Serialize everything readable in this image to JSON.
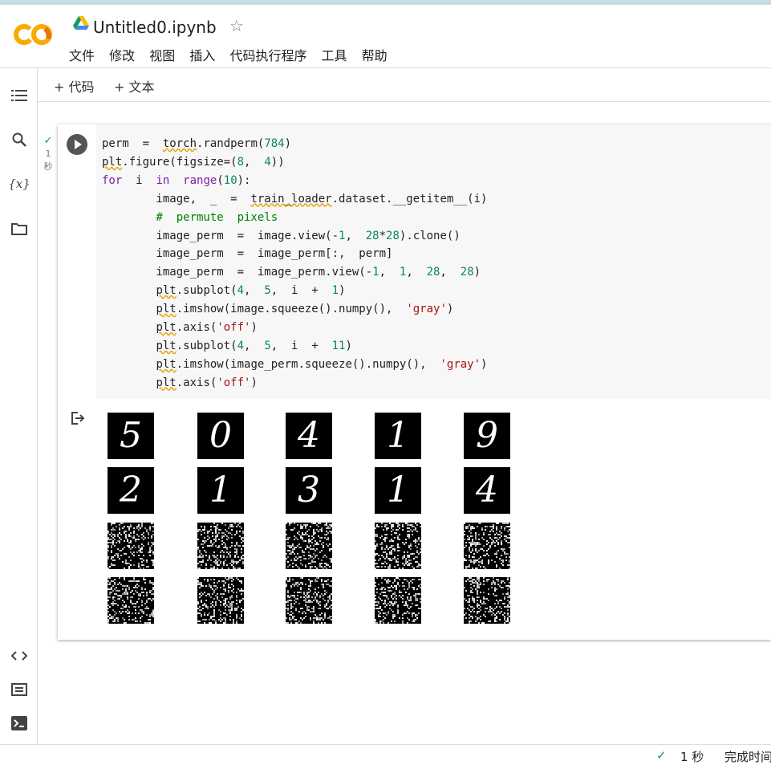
{
  "header": {
    "logo_text": "CO",
    "filename": "Untitled0.ipynb",
    "star_glyph": "☆",
    "menu": [
      "文件",
      "修改",
      "视图",
      "插入",
      "代码执行程序",
      "工具",
      "帮助"
    ]
  },
  "toolbar": {
    "add_code": "代码",
    "add_text": "文本"
  },
  "sidebar": {
    "top_icons": [
      "table-of-contents-icon",
      "search-icon",
      "variables-icon",
      "files-icon"
    ],
    "bottom_icons": [
      "code-snippets-icon",
      "command-palette-icon",
      "terminal-icon"
    ],
    "variables_glyph": "{x}"
  },
  "cell": {
    "exec_status": "1",
    "exec_unit": "秒",
    "code_lines": [
      "perm  =  torch.randperm(784)",
      "plt.figure(figsize=(8,  4))",
      "for  i  in  range(10):",
      "        image,  _  =  train_loader.dataset.__getitem__(i)",
      "        #  permute  pixels",
      "        image_perm  =  image.view(-1,  28*28).clone()",
      "        image_perm  =  image_perm[:,  perm]",
      "        image_perm  =  image_perm.view(-1,  1,  28,  28)",
      "        plt.subplot(4,  5,  i  +  1)",
      "        plt.imshow(image.squeeze().numpy(),  'gray')",
      "        plt.axis('off')",
      "        plt.subplot(4,  5,  i  +  11)",
      "        plt.imshow(image_perm.squeeze().numpy(),  'gray')",
      "        plt.axis('off')"
    ],
    "output": {
      "digit_row_1": [
        "5",
        "0",
        "4",
        "1",
        "9"
      ],
      "digit_row_2": [
        "2",
        "1",
        "3",
        "1",
        "4"
      ],
      "noise_tiles": 10
    }
  },
  "statusbar": {
    "check": "✓",
    "time": "1 秒",
    "label": "完成时间"
  },
  "colors": {
    "logo_orange": "#f9ab00",
    "logo_dark": "#e8710a",
    "check_green": "#0f9d58",
    "keyword": "#7b1fa2",
    "number": "#09885a",
    "string": "#a31515",
    "comment": "#008000"
  }
}
